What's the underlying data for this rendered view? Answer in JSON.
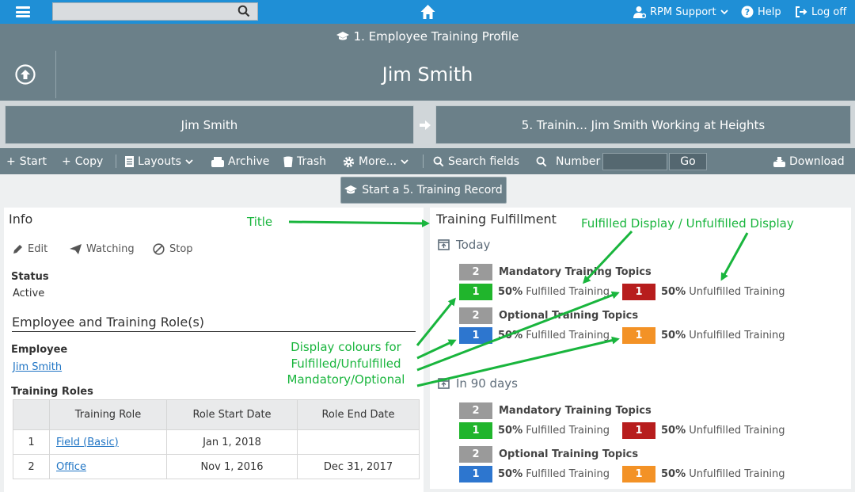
{
  "topbar": {
    "user_menu": "RPM Support",
    "help": "Help",
    "logoff": "Log off",
    "search_placeholder": ""
  },
  "header": {
    "profile_title": "1. Employee Training Profile",
    "name": "Jim Smith"
  },
  "breadcrumb": {
    "current": "Jim Smith",
    "next": "5. Trainin... Jim Smith Working at Heights"
  },
  "toolbar": {
    "start": "Start",
    "copy": "Copy",
    "layouts": "Layouts",
    "archive": "Archive",
    "trash": "Trash",
    "more": "More...",
    "search_fields": "Search fields",
    "number": "Number",
    "go": "Go",
    "download": "Download"
  },
  "start_record": "Start a 5. Training Record",
  "info": {
    "title": "Info",
    "edit": "Edit",
    "watching": "Watching",
    "stop": "Stop",
    "status_label": "Status",
    "status_value": "Active",
    "section_title": "Employee and Training Role(s)",
    "employee_label": "Employee",
    "employee_value": "Jim Smith",
    "roles_label": "Training Roles",
    "roles_columns": [
      "Training Role",
      "Role Start Date",
      "Role End Date"
    ],
    "roles_rows": [
      {
        "n": "1",
        "role": "Field (Basic)",
        "start": "Jan 1, 2018",
        "end": ""
      },
      {
        "n": "2",
        "role": "Office",
        "start": "Nov 1, 2016",
        "end": "Dec 31, 2017"
      }
    ]
  },
  "fulfillment": {
    "title": "Training Fulfillment",
    "today": {
      "label": "Today",
      "mandatory": {
        "count": "2",
        "label": "Mandatory Training Topics",
        "fulfilled_count": "1",
        "fulfilled_pct": "50%",
        "fulfilled_label": "Fulfilled Training",
        "unfulfilled_count": "1",
        "unfulfilled_pct": "50%",
        "unfulfilled_label": "Unfulfilled Training"
      },
      "optional": {
        "count": "2",
        "label": "Optional Training Topics",
        "fulfilled_count": "1",
        "fulfilled_pct": "50%",
        "fulfilled_label": "Fulfilled Training",
        "unfulfilled_count": "1",
        "unfulfilled_pct": "50%",
        "unfulfilled_label": "Unfulfilled Training"
      }
    },
    "in90": {
      "label": "In 90 days",
      "mandatory": {
        "count": "2",
        "label": "Mandatory Training Topics",
        "fulfilled_count": "1",
        "fulfilled_pct": "50%",
        "fulfilled_label": "Fulfilled Training",
        "unfulfilled_count": "1",
        "unfulfilled_pct": "50%",
        "unfulfilled_label": "Unfulfilled Training"
      },
      "optional": {
        "count": "2",
        "label": "Optional Training Topics",
        "fulfilled_count": "1",
        "fulfilled_pct": "50%",
        "fulfilled_label": "Fulfilled Training",
        "unfulfilled_count": "1",
        "unfulfilled_pct": "50%",
        "unfulfilled_label": "Unfulfilled Training"
      }
    }
  },
  "annotations": {
    "title": "Title",
    "display": "Fulfilled Display / Unfulfilled Display",
    "colours_1": "Display colours for",
    "colours_2": "Fulfilled/Unfulfilled",
    "colours_3": "Mandatory/Optional"
  },
  "colors": {
    "topbar": "#1f8fd6",
    "header": "#6b8089",
    "mandatory_fulfilled": "#20b52c",
    "mandatory_unfulfilled": "#b71d1d",
    "optional_fulfilled": "#2d76cf",
    "optional_unfulfilled": "#f39226",
    "total": "#9a9a9a",
    "annotation": "#19b53d"
  }
}
